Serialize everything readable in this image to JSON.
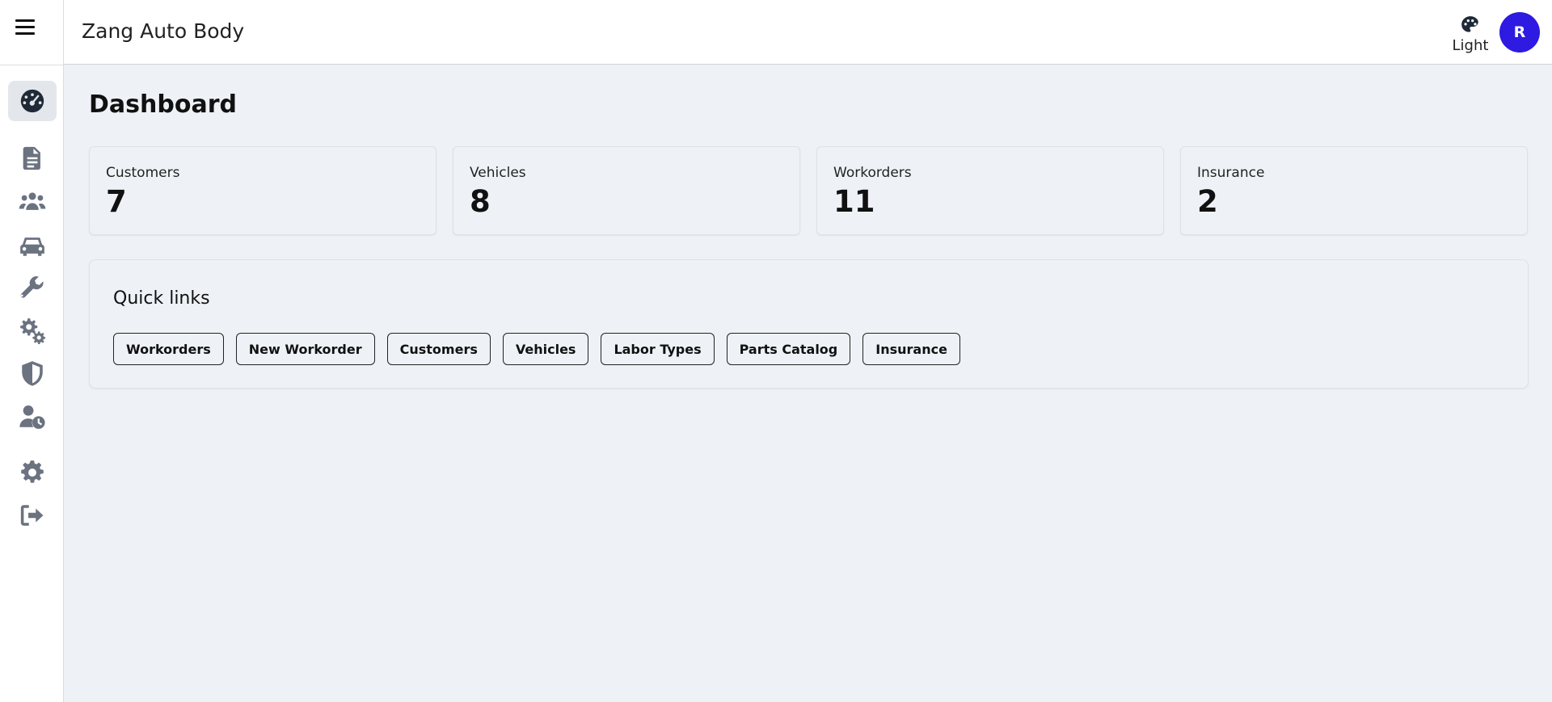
{
  "app": {
    "title": "Zang Auto Body"
  },
  "header": {
    "theme_label": "Light",
    "avatar_initial": "R"
  },
  "sidebar": {
    "items": [
      {
        "name": "dashboard",
        "icon": "dashboard-gauge-icon",
        "active": true
      },
      {
        "name": "workorders",
        "icon": "document-icon"
      },
      {
        "name": "customers",
        "icon": "users-icon"
      },
      {
        "name": "vehicles",
        "icon": "car-icon"
      },
      {
        "name": "labor-types",
        "icon": "wrench-icon"
      },
      {
        "name": "parts",
        "icon": "gears-icon"
      },
      {
        "name": "insurance",
        "icon": "shield-icon"
      },
      {
        "name": "user-clock",
        "icon": "user-clock-icon"
      },
      {
        "name": "settings",
        "icon": "gear-icon"
      },
      {
        "name": "logout",
        "icon": "logout-icon"
      }
    ]
  },
  "main": {
    "title": "Dashboard",
    "stats": [
      {
        "label": "Customers",
        "value": "7"
      },
      {
        "label": "Vehicles",
        "value": "8"
      },
      {
        "label": "Workorders",
        "value": "11"
      },
      {
        "label": "Insurance",
        "value": "2"
      }
    ],
    "quick_links": {
      "title": "Quick links",
      "buttons": [
        "Workorders",
        "New Workorder",
        "Customers",
        "Vehicles",
        "Labor Types",
        "Parts Catalog",
        "Insurance"
      ]
    }
  },
  "colors": {
    "accent": "#2e1ae0",
    "background": "#eef2f6",
    "icon": "#6b7280"
  }
}
